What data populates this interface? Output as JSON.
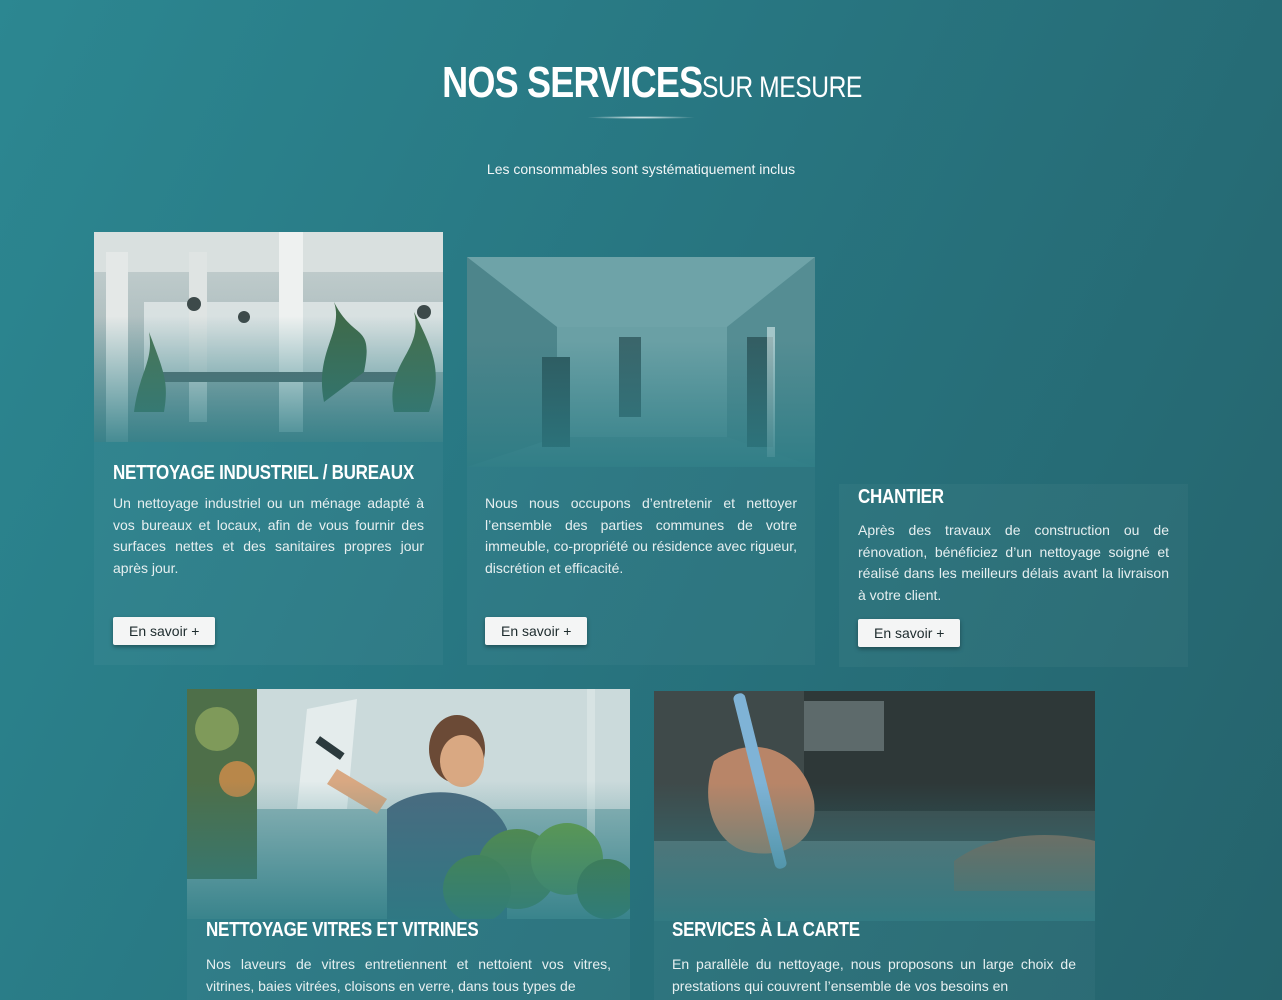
{
  "header": {
    "title_main": "NOS SERVICES",
    "title_sub": "SUR MESURE",
    "subtitle": "Les consommables sont systématiquement inclus"
  },
  "colors": {
    "background": "#287681",
    "button_bg": "#f4f5f5",
    "button_text": "#1d2b2d"
  },
  "cards": [
    {
      "title": "NETTOYAGE INDUSTRIEL / BUREAUX",
      "text": "Un nettoyage industriel ou un ménage adapté à vos bureaux et locaux, afin de vous fournir des surfaces nettes et des sanitaires propres jour après jour.",
      "button": "En savoir +",
      "image": "office-interior-photo"
    },
    {
      "title": "",
      "text": "Nous nous occupons d’entretenir et nettoyer l’ensemble des parties communes de votre immeuble, co-propriété ou résidence avec rigueur, discrétion et efficacité.",
      "button": "En savoir +",
      "image": "hallway-photo"
    },
    {
      "title": "CHANTIER",
      "text": "Après des travaux de construction ou de rénovation, bénéficiez d’un nettoyage soigné et réalisé dans les meilleurs délais avant la livraison à votre client.",
      "button": "En savoir +"
    },
    {
      "title": "NETTOYAGE VITRES ET VITRINES",
      "text": "Nos laveurs de vitres entretiennent et nettoient vos vitres, vitrines, baies vitrées, cloisons en verre, dans tous types de",
      "image": "window-cleaner-photo"
    },
    {
      "title": "SERVICES À LA CARTE",
      "text": "En parallèle du nettoyage, nous proposons un large choix de prestations qui couvrent l’ensemble de vos besoins en",
      "image": "writing-hand-photo"
    }
  ]
}
